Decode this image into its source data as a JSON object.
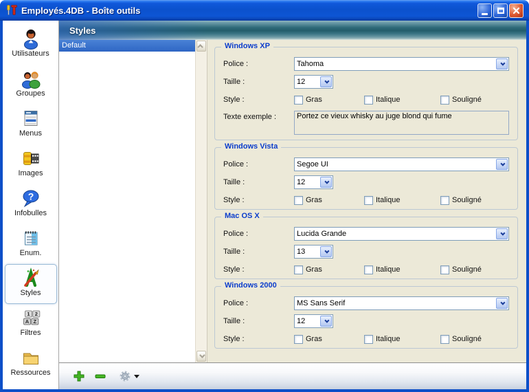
{
  "window": {
    "title": "Employés.4DB - Boîte outils"
  },
  "header": {
    "title": "Styles"
  },
  "sidebar": {
    "items": [
      {
        "label": "Utilisateurs",
        "icon": "users-icon",
        "selected": false
      },
      {
        "label": "Groupes",
        "icon": "groups-icon",
        "selected": false
      },
      {
        "label": "Menus",
        "icon": "menus-icon",
        "selected": false
      },
      {
        "label": "Images",
        "icon": "film-icon",
        "selected": false
      },
      {
        "label": "Infobulles",
        "icon": "tooltip-bubble-icon",
        "selected": false
      },
      {
        "label": "Enum.",
        "icon": "notepad-icon",
        "selected": false
      },
      {
        "label": "Styles",
        "icon": "paint-letter-icon",
        "selected": true
      },
      {
        "label": "Filtres",
        "icon": "filter-keys-icon",
        "selected": false
      },
      {
        "label": "Ressources",
        "icon": "folder-icon",
        "selected": false
      }
    ]
  },
  "list": {
    "items": [
      {
        "label": "Default",
        "selected": true
      }
    ]
  },
  "labels": {
    "police": "Police :",
    "taille": "Taille :",
    "style": "Style :",
    "gras": "Gras",
    "italique": "Italique",
    "souligne": "Souligné",
    "sample": "Texte exemple :"
  },
  "sections": [
    {
      "title": "Windows XP",
      "police": "Tahoma",
      "taille": "12",
      "checks": {
        "gras": false,
        "italique": false,
        "souligne": false
      },
      "sample_text": "Portez ce vieux whisky au juge blond qui fume"
    },
    {
      "title": "Windows Vista",
      "police": "Segoe UI",
      "taille": "12",
      "checks": {
        "gras": false,
        "italique": false,
        "souligne": false
      }
    },
    {
      "title": "Mac OS X",
      "police": "Lucida Grande",
      "taille": "13",
      "checks": {
        "gras": false,
        "italique": false,
        "souligne": false
      }
    },
    {
      "title": "Windows 2000",
      "police": "MS Sans Serif",
      "taille": "12",
      "checks": {
        "gras": false,
        "italique": false,
        "souligne": false
      }
    }
  ],
  "colors": {
    "titlebar_blue": "#0b51cd",
    "header_teal": "#235d6b",
    "selection_blue": "#316ac5",
    "panel_beige": "#ece9d8",
    "section_title_blue": "#0b3dcc",
    "control_border_blue": "#7f9db9",
    "toolbar_green": "#45b525",
    "close_button_red": "#de5b34"
  }
}
